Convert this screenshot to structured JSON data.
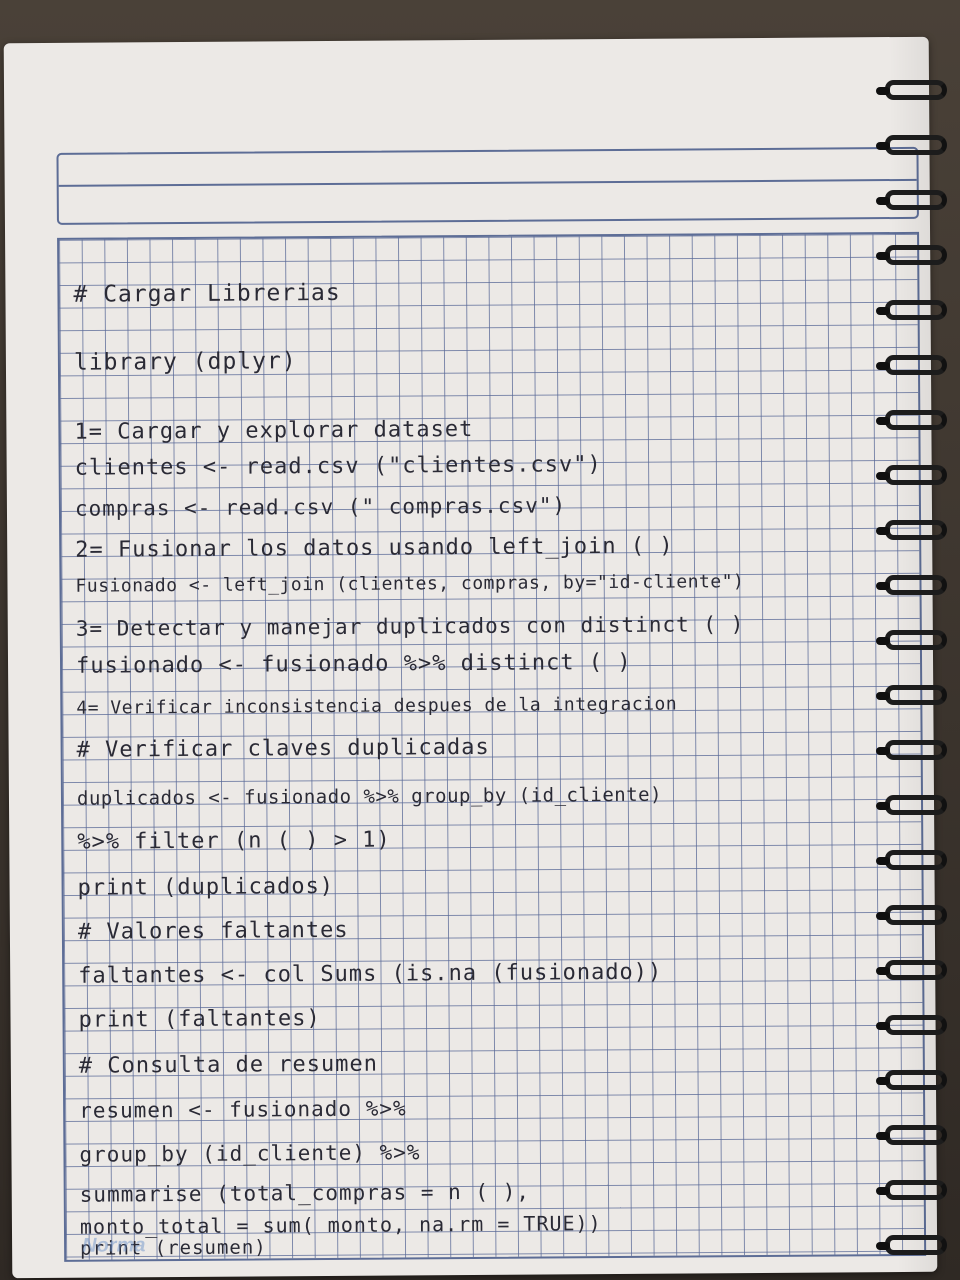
{
  "notebook": {
    "lines": [
      "# Cargar Librerias",
      "library (dplyr)",
      "1= Cargar y explorar dataset",
      "clientes <- read.csv (\"clientes.csv\")",
      "compras <- read.csv (\" compras.csv\")",
      "2= Fusionar los datos usando left_join ( )",
      "Fusionado <- left_join (clientes, compras, by=\"id-cliente\")",
      "3= Detectar y manejar duplicados con distinct ( )",
      "fusionado <- fusionado %>% distinct ( )",
      "4= Verificar inconsistencia despues de la integracion",
      "# Verificar claves duplicadas",
      "duplicados <- fusionado %>% group_by (id_cliente)",
      "%>% filter (n ( ) > 1)",
      "print (duplicados)",
      "# Valores faltantes",
      "faltantes <- col Sums (is.na (fusionado))",
      "print (faltantes)",
      "# Consulta de resumen",
      "resumen <- fusionado %>%",
      "group_by (id_cliente) %>%",
      "summarise (total_compras = n ( ),",
      "monto_total = sum( monto, na.rm = TRUE))",
      "print (resumen)"
    ]
  },
  "watermark": "Norma",
  "colors": {
    "paper": "#ece9e6",
    "grid": "#5d6d96",
    "ink": "#2a2a35"
  }
}
